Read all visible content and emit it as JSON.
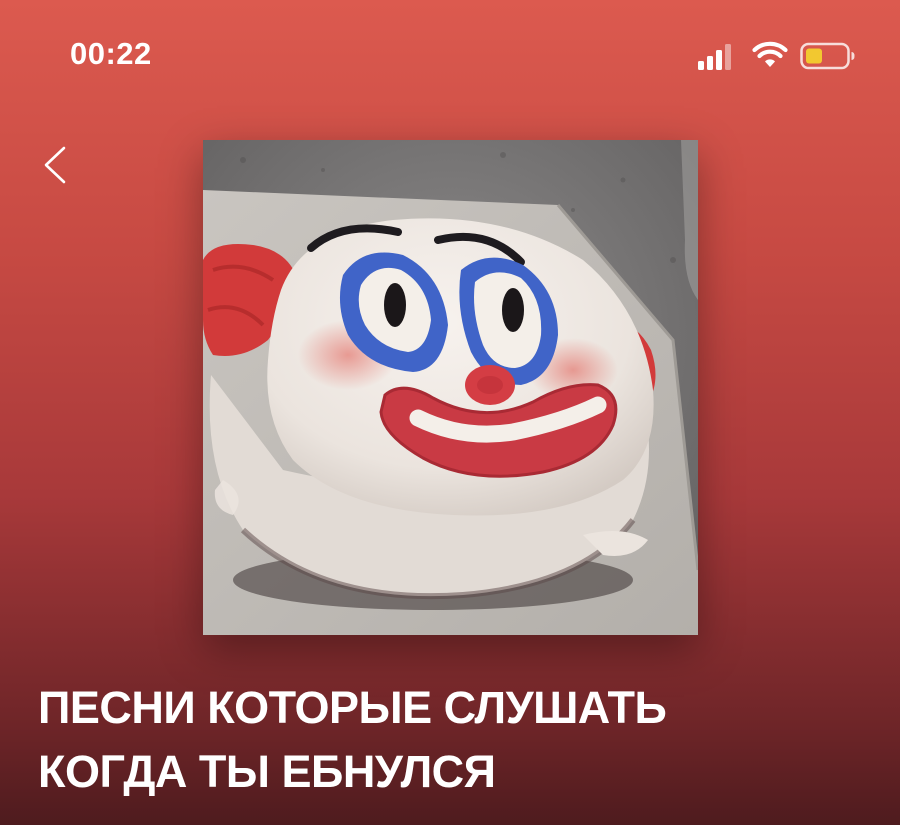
{
  "status_bar": {
    "time": "00:22",
    "signal_icon": "cellular-signal-icon",
    "wifi_icon": "wifi-icon",
    "battery_icon": "battery-low-icon",
    "battery_color": "#f2c830"
  },
  "navigation": {
    "back_icon": "chevron-left-icon"
  },
  "cover": {
    "image": "clown-face-cake-photo"
  },
  "playlist": {
    "title_line1": "ПЕСНИ КОТОРЫЕ СЛУШАТЬ",
    "title_line2": "КОГДА ТЫ ЕБНУЛСЯ"
  },
  "colors": {
    "background_top": "#dc5a4f",
    "background_bottom": "#4e1b1e",
    "text": "#ffffff"
  }
}
